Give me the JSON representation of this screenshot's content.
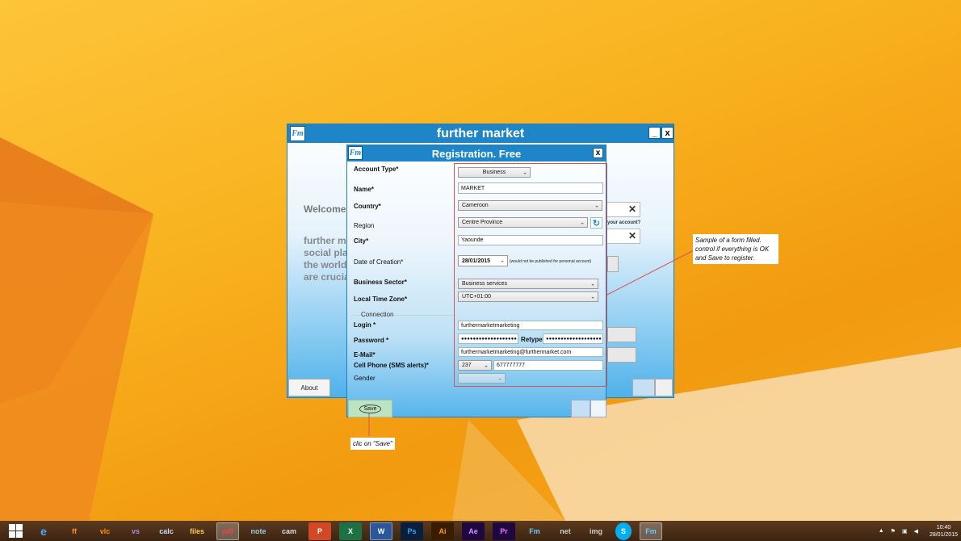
{
  "main_window": {
    "title": "further market",
    "minimize_label": "_",
    "close_label": "x",
    "welcome": "Welcome.",
    "blurb_lines": [
      "further market",
      "social place",
      "the world,",
      "are crucial"
    ],
    "account_hint": "your account?",
    "about_label": "About"
  },
  "registration": {
    "title": "Registration. Free",
    "close_label": "x",
    "fields": {
      "account_type": {
        "label": "Account Type*",
        "value": "Business"
      },
      "name": {
        "label": "Name*",
        "value": "MARKET"
      },
      "country": {
        "label": "Country*",
        "value": "Cameroon"
      },
      "region": {
        "label": "Region",
        "value": "Centre Province"
      },
      "city": {
        "label": "City*",
        "value": "Yaounde"
      },
      "date_of_creation": {
        "label": "Date of Creation*",
        "value": "28/01/2015",
        "note": "(would not be published for personal account)"
      },
      "business_sector": {
        "label": "Business Sector*",
        "value": "Business services"
      },
      "time_zone": {
        "label": "Local Time Zone*",
        "value": "UTC+01:00"
      },
      "connection_group": "Connection",
      "login": {
        "label": "Login *",
        "value": "furthermarketmarketing"
      },
      "password": {
        "label": "Password *",
        "value": "●●●●●●●●●●●●●●●●●●●"
      },
      "retype": {
        "label": "Retype*",
        "value": "●●●●●●●●●●●●●●●●●●●"
      },
      "email": {
        "label": "E-Mail*",
        "value": "furthermarketmarketing@furthermarket.com"
      },
      "cell_phone": {
        "label": "Cell Phone (SMS alerts)*",
        "code": "237",
        "value": "677777777"
      },
      "gender": {
        "label": "Gender",
        "value": ""
      }
    },
    "save_label": "Save"
  },
  "annotations": {
    "form_callout": "Sample of a form filled. control if everything is OK and Save to register.",
    "save_callout": "clic on \"Save\""
  },
  "taskbar": {
    "apps": [
      "e",
      "ff",
      "vlc",
      "vs",
      "calc",
      "files",
      "pdf",
      "note",
      "cam",
      "P",
      "X",
      "W",
      "Ps",
      "Ai",
      "Ae",
      "Pr",
      "Fm",
      "net",
      "img",
      "S",
      "Fm"
    ],
    "time": "10:40",
    "date": "28/01/2015"
  },
  "colors": {
    "title_bar": "#1f85c9",
    "accent_red": "#d9534f"
  }
}
